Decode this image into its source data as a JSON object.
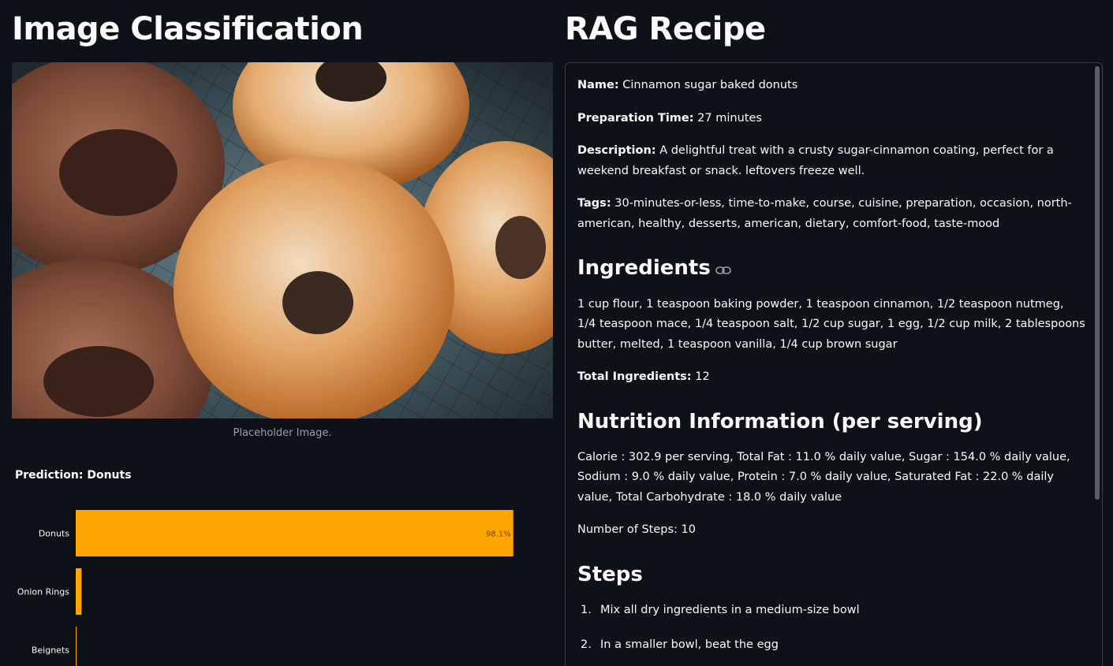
{
  "left": {
    "title": "Image Classification",
    "image_caption": "Placeholder Image.",
    "prediction": "Prediction: Donuts"
  },
  "chart_data": {
    "type": "bar",
    "orientation": "horizontal",
    "categories": [
      "Donuts",
      "Onion Rings",
      "Beignets"
    ],
    "values": [
      98.1,
      1.3,
      0.2
    ],
    "data_labels": [
      "98.1%",
      "",
      ""
    ],
    "xlim": [
      0,
      100
    ],
    "bar_color": "#ffa500"
  },
  "right": {
    "title": "RAG Recipe",
    "name_label": "Name:",
    "name_value": " Cinnamon sugar baked donuts",
    "prep_label": "Preparation Time:",
    "prep_value": " 27 minutes",
    "desc_label": "Description:",
    "desc_value": " A delightful treat with a crusty sugar-cinnamon coating, perfect for a weekend breakfast or snack. leftovers freeze well.",
    "tags_label": "Tags:",
    "tags_value": " 30-minutes-or-less, time-to-make, course, cuisine, preparation, occasion, north-american, healthy, desserts, american, dietary, comfort-food, taste-mood",
    "ingredients_heading": "Ingredients",
    "ingredients_text": "1 cup flour, 1 teaspoon baking powder, 1 teaspoon cinnamon, 1/2 teaspoon nutmeg, 1/4 teaspoon mace, 1/4 teaspoon salt, 1/2 cup sugar, 1 egg, 1/2 cup milk, 2 tablespoons butter, melted, 1 teaspoon vanilla, 1/4 cup brown sugar",
    "total_ingredients_label": "Total Ingredients:",
    "total_ingredients_value": " 12",
    "nutrition_heading": "Nutrition Information (per serving)",
    "nutrition_text": "Calorie : 302.9 per serving, Total Fat : 11.0 % daily value, Sugar : 154.0 % daily value, Sodium : 9.0 % daily value, Protein : 7.0 % daily value, Saturated Fat : 22.0 % daily value, Total Carbohydrate : 18.0 % daily value",
    "steps_count_text": "Number of Steps: 10",
    "steps_heading": "Steps",
    "steps": [
      {
        "num": "1.",
        "text": "Mix all dry ingredients in a medium-size bowl"
      },
      {
        "num": "2.",
        "text": "In a smaller bowl, beat the egg"
      }
    ]
  },
  "icons": {
    "heading_anchor": "link-icon"
  }
}
